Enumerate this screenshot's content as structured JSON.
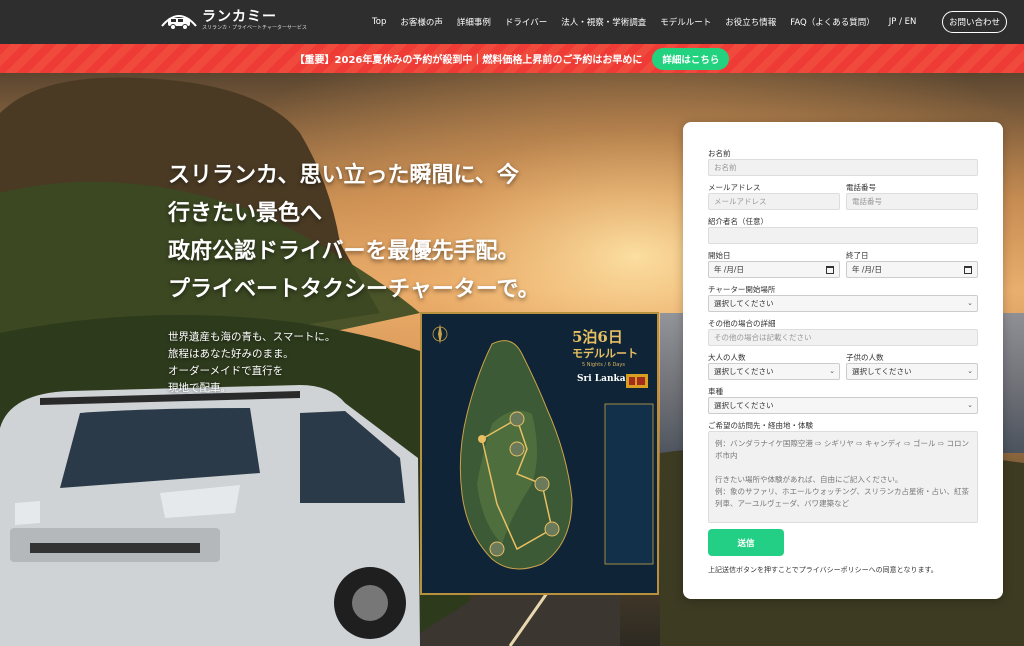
{
  "header": {
    "logo_title": "ランカミー",
    "logo_sub": "スリランカ・プライベートチャーターサービス",
    "nav": [
      "Top",
      "お客様の声",
      "詳細事例",
      "ドライバー",
      "法人・視察・学術調査",
      "モデルルート",
      "お役立ち情報",
      "FAQ（よくある質問）",
      "JP / EN"
    ],
    "contact_label": "お問い合わせ"
  },
  "announce": {
    "text": "【重要】2026年夏休みの予約が殺到中｜燃料価格上昇前のご予約はお早めに",
    "button_label": "詳細はこちら"
  },
  "hero": {
    "title_lines": [
      "スリランカ、思い立った瞬間に、今",
      "行きたい景色へ",
      "政府公認ドライバーを最優先手配。",
      "プライベートタクシーチャーターで。"
    ],
    "sub_lines": [
      "世界遺産も海の青も、スマートに。",
      "旅程はあなた好みのまま。",
      "オーダーメイドで直行を",
      "現地で配車。"
    ]
  },
  "poster": {
    "title": "5泊6日",
    "title2": "モデルルート",
    "subtitle_en": "5 Nights / 6 Days",
    "country": "Sri Lanka"
  },
  "form": {
    "name_label": "お名前",
    "name_placeholder": "お名前",
    "email_label": "メールアドレス",
    "email_placeholder": "メールアドレス",
    "phone_label": "電話番号",
    "phone_placeholder": "電話番号",
    "referrer_label": "紹介者名（任意）",
    "start_label": "開始日",
    "start_value": "年 /月/日",
    "end_label": "終了日",
    "end_value": "年 /月/日",
    "pickup_label": "チャーター開始場所",
    "pickup_value": "選択してください",
    "other_label": "その他の場合の詳細",
    "other_placeholder": "その他の場合は記載ください",
    "adults_label": "大人の人数",
    "adults_value": "選択してください",
    "children_label": "子供の人数",
    "children_value": "選択してください",
    "vehicle_label": "車種",
    "vehicle_value": "選択してください",
    "wish_label": "ご希望の訪問先・経由地・体験",
    "wish_placeholder": "例：バンダラナイケ国際空港 ⇨ シギリヤ ⇨ キャンディ ⇨ ゴール ⇨ コロンボ市内\n\n行きたい場所や体験があれば、自由にご記入ください。\n例：象のサファリ、ホエールウォッチング、スリランカ占星術・占い、紅茶列車、アーユルヴェーダ、バワ建築など",
    "submit_label": "送信",
    "privacy_note": "上記送信ボタンを押すことでプライバシーポリシーへの同意となります。"
  }
}
